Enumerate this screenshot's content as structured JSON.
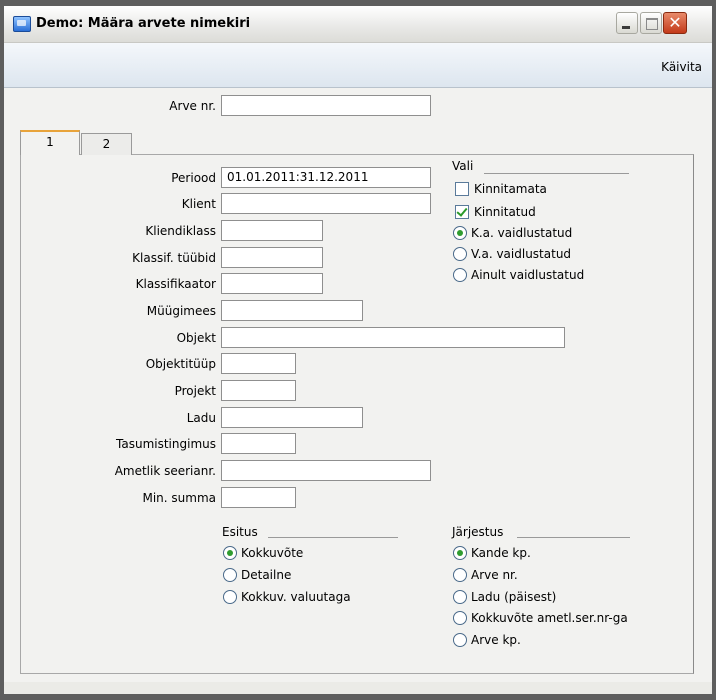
{
  "window": {
    "title": "Demo: Määra arvete nimekiri"
  },
  "toolbar": {
    "run_label": "Käivita"
  },
  "header_field": {
    "label": "Arve nr.",
    "value": ""
  },
  "tabs": [
    {
      "label": "1"
    },
    {
      "label": "2"
    }
  ],
  "fields": {
    "periood": {
      "label": "Periood",
      "value": "01.01.2011:31.12.2011"
    },
    "klient": {
      "label": "Klient",
      "value": ""
    },
    "kliendiklass": {
      "label": "Kliendiklass",
      "value": ""
    },
    "klassif_tyybid": {
      "label": "Klassif. tüübid",
      "value": ""
    },
    "klassifikaator": {
      "label": "Klassifikaator",
      "value": ""
    },
    "myygimees": {
      "label": "Müügimees",
      "value": ""
    },
    "objekt": {
      "label": "Objekt",
      "value": ""
    },
    "objektityyp": {
      "label": "Objektitüüp",
      "value": ""
    },
    "projekt": {
      "label": "Projekt",
      "value": ""
    },
    "ladu": {
      "label": "Ladu",
      "value": ""
    },
    "tasumistingimus": {
      "label": "Tasumistingimus",
      "value": ""
    },
    "ametlik_seerianr": {
      "label": "Ametlik seerianr.",
      "value": ""
    },
    "min_summa": {
      "label": "Min. summa",
      "value": ""
    }
  },
  "vali": {
    "title": "Vali",
    "checkboxes": [
      {
        "label": "Kinnitamata",
        "checked": false
      },
      {
        "label": "Kinnitatud",
        "checked": true
      }
    ],
    "radios": [
      {
        "label": "K.a. vaidlustatud",
        "selected": true
      },
      {
        "label": "V.a. vaidlustatud",
        "selected": false
      },
      {
        "label": "Ainult vaidlustatud",
        "selected": false
      }
    ]
  },
  "esitus": {
    "title": "Esitus",
    "radios": [
      {
        "label": "Kokkuvõte",
        "selected": true
      },
      {
        "label": "Detailne",
        "selected": false
      },
      {
        "label": "Kokkuv. valuutaga",
        "selected": false
      }
    ]
  },
  "jarjestus": {
    "title": "Järjestus",
    "radios": [
      {
        "label": "Kande kp.",
        "selected": true
      },
      {
        "label": "Arve nr.",
        "selected": false
      },
      {
        "label": "Ladu (päisest)",
        "selected": false
      },
      {
        "label": "Kokkuvõte ametl.ser.nr-ga",
        "selected": false
      },
      {
        "label": "Arve kp.",
        "selected": false
      }
    ]
  }
}
